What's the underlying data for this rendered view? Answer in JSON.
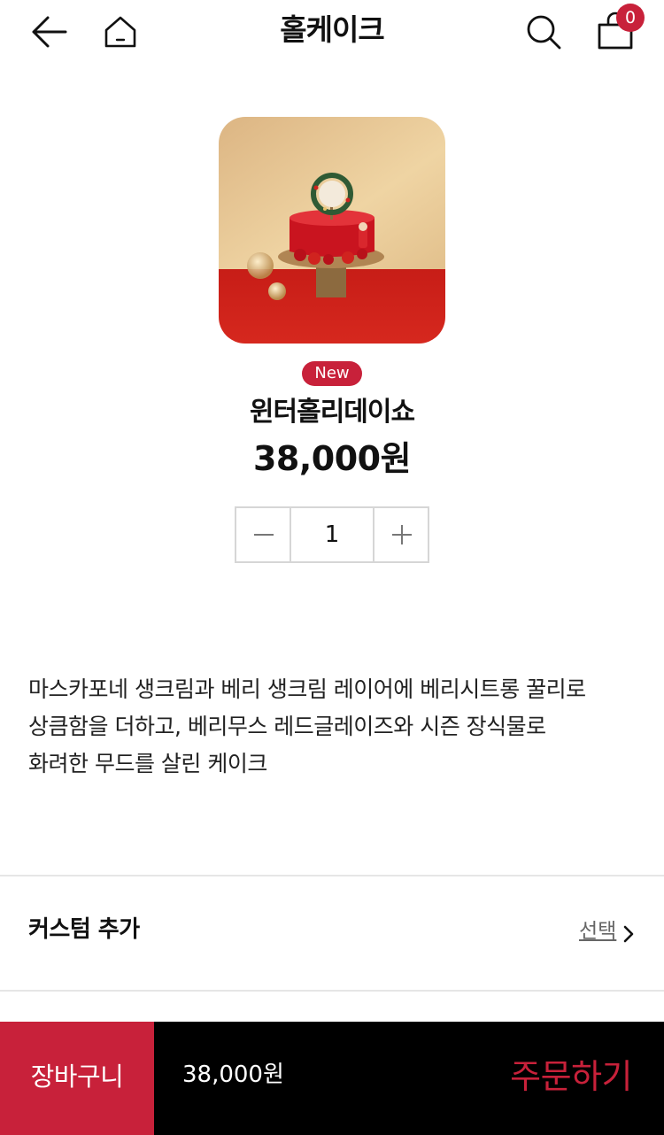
{
  "header": {
    "title": "홀케이크",
    "back_icon": "arrow-left-icon",
    "home_icon": "home-icon",
    "search_icon": "search-icon",
    "cart_icon": "shopping-bag-icon",
    "cart_count": "0"
  },
  "product": {
    "badge": "New",
    "name": "윈터홀리데이쇼",
    "price": "38,000원",
    "quantity": "1"
  },
  "description": {
    "lines": [
      "마스카포네 생크림과 베리 생크림 레이어에 베리시트롱 꿀리로",
      "상큼함을 더하고, 베리무스 레드글레이즈와 시즌 장식물로",
      "화려한 무드를 살린 케이크"
    ]
  },
  "custom": {
    "label": "커스텀 추가",
    "select_label": "선택"
  },
  "bottom_bar": {
    "cart_label": "장바구니",
    "total": "38,000원",
    "order_label": "주문하기"
  },
  "colors": {
    "accent": "#c8213a",
    "bottom_bar": "#000000",
    "divider": "#e6e6e6"
  }
}
